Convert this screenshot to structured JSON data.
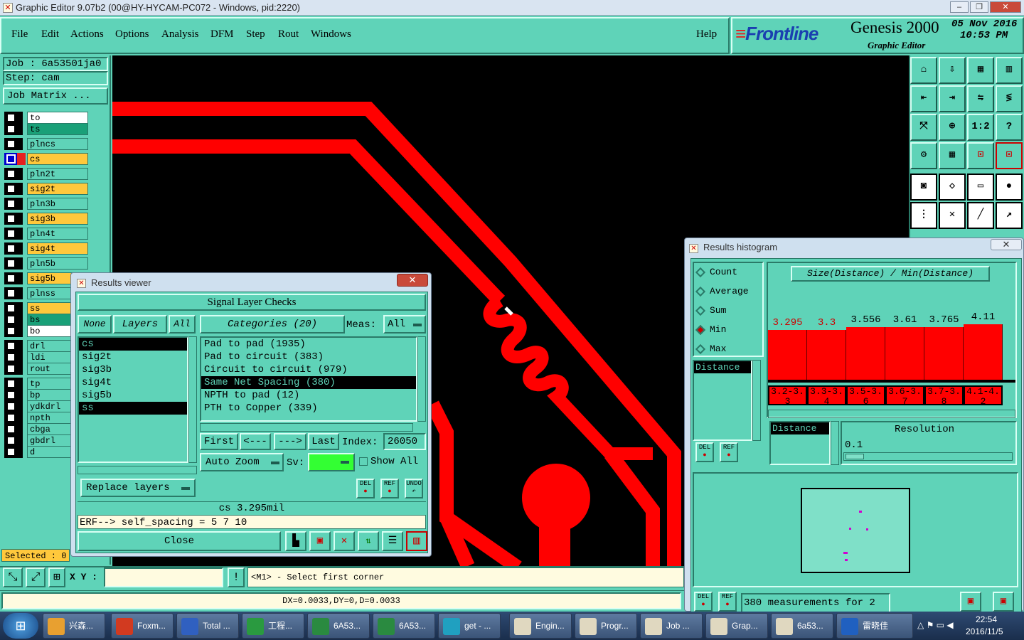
{
  "window": {
    "title": "Graphic Editor 9.07b2 (00@HY-HYCAM-PC072 - Windows, pid:2220)",
    "min": "–",
    "max": "❐",
    "close": "✕"
  },
  "menu": {
    "items": [
      "File",
      "Edit",
      "Actions",
      "Options",
      "Analysis",
      "DFM",
      "Step",
      "Rout",
      "Windows"
    ],
    "help": "Help"
  },
  "brand": {
    "logo": "Frontline",
    "product": "Genesis 2000",
    "subtitle": "Graphic Editor",
    "date": "05 Nov 2016",
    "time": "10:53 PM"
  },
  "job": {
    "job_label": "Job : 6a53501ja0",
    "step_label": "Step: cam",
    "matrix_button": "Job Matrix ..."
  },
  "layers": [
    {
      "name": "to",
      "color": "#ffffff"
    },
    {
      "name": "ts",
      "color": "#1aa078"
    },
    {
      "name": "plncs",
      "color": "#5fd3b8"
    },
    {
      "name": "cs",
      "color": "#ffc83c",
      "active": true
    },
    {
      "name": "pln2t",
      "color": "#5fd3b8"
    },
    {
      "name": "sig2t",
      "color": "#ffc83c"
    },
    {
      "name": "pln3b",
      "color": "#5fd3b8"
    },
    {
      "name": "sig3b",
      "color": "#ffc83c"
    },
    {
      "name": "pln4t",
      "color": "#5fd3b8"
    },
    {
      "name": "sig4t",
      "color": "#ffc83c"
    },
    {
      "name": "pln5b",
      "color": "#5fd3b8"
    },
    {
      "name": "sig5b",
      "color": "#ffc83c"
    },
    {
      "name": "plnss",
      "color": "#5fd3b8"
    },
    {
      "name": "ss",
      "color": "#ffc83c"
    },
    {
      "name": "bs",
      "color": "#1aa078"
    },
    {
      "name": "bo",
      "color": "#ffffff"
    },
    {
      "name": "drl",
      "color": "#5fd3b8"
    },
    {
      "name": "ldi",
      "color": "#5fd3b8"
    },
    {
      "name": "rout",
      "color": "#5fd3b8"
    },
    {
      "name": "tp",
      "color": "#5fd3b8"
    },
    {
      "name": "bp",
      "color": "#5fd3b8"
    },
    {
      "name": "ydkdrl",
      "color": "#5fd3b8"
    },
    {
      "name": "npth",
      "color": "#5fd3b8"
    },
    {
      "name": "cbga",
      "color": "#5fd3b8"
    },
    {
      "name": "gbdrl",
      "color": "#5fd3b8"
    },
    {
      "name": "d",
      "color": "#5fd3b8"
    }
  ],
  "selected": "Selected : 0",
  "results_viewer": {
    "title": "Results viewer",
    "header": "Signal Layer Checks",
    "none_btn": "None",
    "layers_btn": "Layers",
    "all_btn": "All",
    "categories_btn": "Categories (20)",
    "meas_label": "Meas:",
    "meas_value": "All",
    "layer_list": [
      "cs",
      "sig2t",
      "sig3b",
      "sig4t",
      "sig5b",
      "ss"
    ],
    "layer_selected": [
      0,
      5
    ],
    "category_list": [
      "Pad to pad (1935)",
      "Pad to circuit (383)",
      "Circuit to circuit (979)",
      "Same Net Spacing (380)",
      "NPTH to pad (12)",
      "PTH to Copper (339)"
    ],
    "category_selected": 3,
    "first": "First",
    "prev": "<---",
    "next": "--->",
    "last": "Last",
    "index_label": "Index:",
    "index_value": "26050",
    "zoom": "Auto Zoom",
    "sv_label": "Sv:",
    "show_all": "Show All",
    "replace": "Replace layers",
    "del": "DEL",
    "ref": "REF",
    "undo": "UNDO",
    "status": "cs 3.295mil",
    "erf": "ERF--> self_spacing = 5 7 10",
    "close": "Close"
  },
  "histogram": {
    "title": "Results histogram",
    "options": [
      "Count",
      "Average",
      "Sum",
      "Min",
      "Max"
    ],
    "selected_option": "Min",
    "header": "Size(Distance) / Min(Distance)",
    "bars": [
      {
        "value": "3.295",
        "range": "3.2-3.3",
        "level": 0.7
      },
      {
        "value": "3.3",
        "range": "3.3-3.4",
        "level": 0.7
      },
      {
        "value": "3.556",
        "range": "3.5-3.6",
        "level": 0.75
      },
      {
        "value": "3.61",
        "range": "3.6-3.7",
        "level": 0.75
      },
      {
        "value": "3.765",
        "range": "3.7-3.8",
        "level": 0.75
      },
      {
        "value": "4.11",
        "range": "4.1-4.2",
        "level": 0.8
      }
    ],
    "list_item": "Distance",
    "res_list_item": "Distance",
    "resolution_label": "Resolution",
    "resolution_value": "0.1",
    "del": "DEL",
    "ref": "REF",
    "measurements": "380 measurements for 2"
  },
  "prompt": {
    "xy_label": "X Y :",
    "message": "<M1> - Select first corner",
    "coords": "DX=0.0033,DY=0,D=0.0033"
  },
  "taskbar": {
    "items": [
      "兴森...",
      "Foxm...",
      "Total ...",
      "工程...",
      "6A53...",
      "6A53...",
      "get - ...",
      "Engin...",
      "Progr...",
      "Job ...",
      "Grap...",
      "6a53...",
      "雷晓佳"
    ],
    "clock_time": "22:54",
    "clock_date": "2016/11/5"
  },
  "colors": {
    "panel": "#5fd3b8",
    "trace": "#ff0000",
    "canvas": "#000000",
    "highlight": "#ffc83c"
  }
}
